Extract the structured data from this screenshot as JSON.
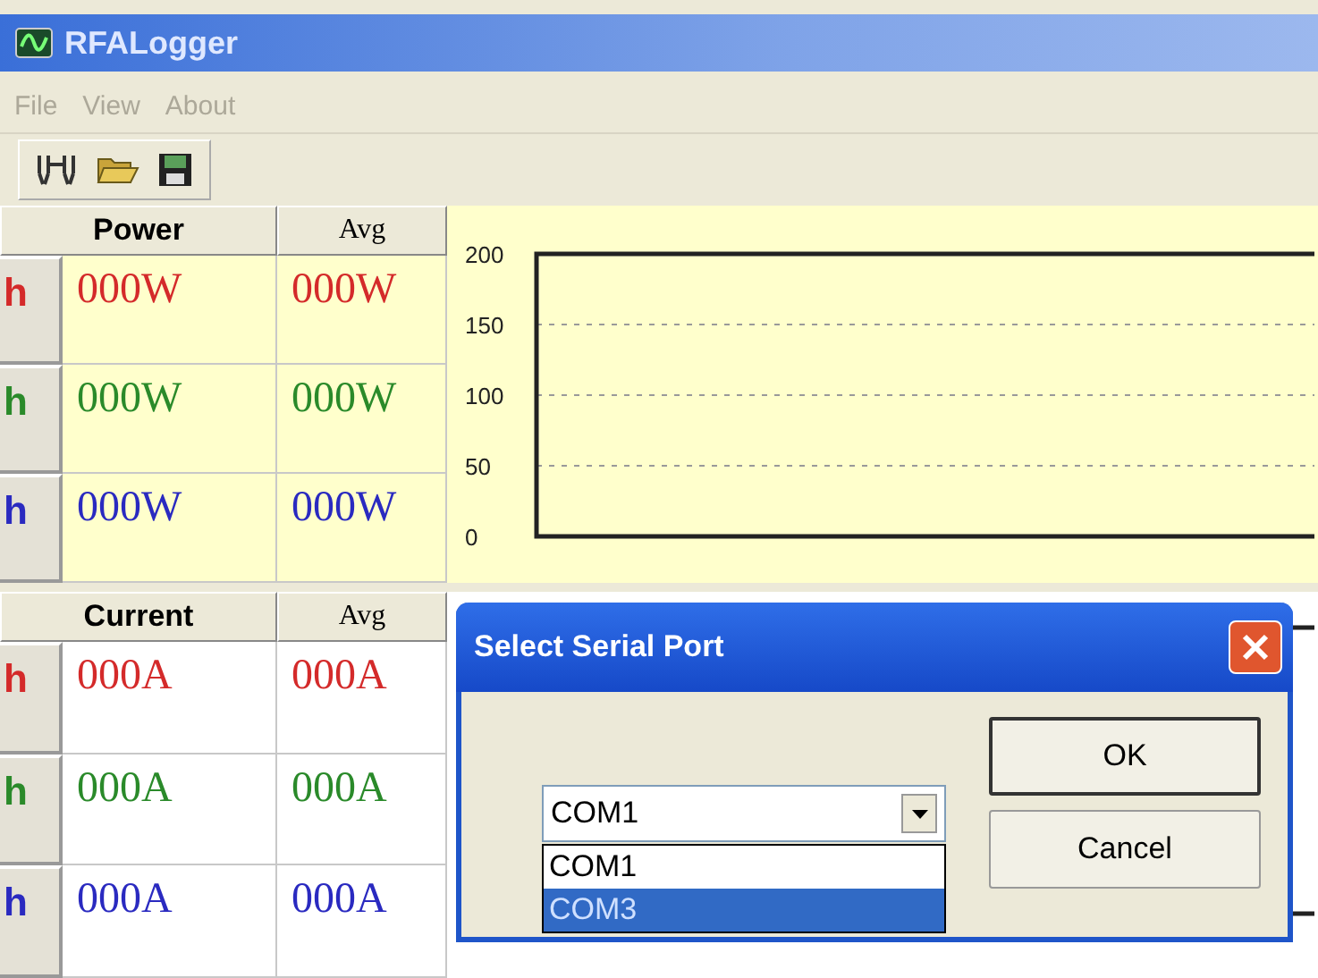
{
  "window": {
    "title": "RFALogger"
  },
  "menu": [
    {
      "label": "File",
      "disabled": true
    },
    {
      "label": "View",
      "disabled": true
    },
    {
      "label": "About",
      "disabled": true
    }
  ],
  "power": {
    "header": "Power",
    "avg_header": "Avg",
    "rows": [
      {
        "label": "h",
        "value": "000W",
        "avg": "000W",
        "color": "#d42a2a"
      },
      {
        "label": "h",
        "value": "000W",
        "avg": "000W",
        "color": "#2a8a2a"
      },
      {
        "label": "h",
        "value": "000W",
        "avg": "000W",
        "color": "#2a2ac0"
      }
    ]
  },
  "power_chart": {
    "y_labels": [
      "200",
      "150",
      "100",
      "50",
      "0"
    ]
  },
  "current": {
    "header": "Current",
    "avg_header": "Avg",
    "rows": [
      {
        "label": "h",
        "value": "000A",
        "avg": "000A",
        "color": "#d42a2a"
      },
      {
        "label": "h",
        "value": "000A",
        "avg": "000A",
        "color": "#2a8a2a"
      },
      {
        "label": "h",
        "value": "000A",
        "avg": "000A",
        "color": "#2a2ac0"
      }
    ]
  },
  "dialog": {
    "title": "Select Serial Port",
    "combo_value": "COM1",
    "options": [
      {
        "label": "COM1",
        "selected": false
      },
      {
        "label": "COM3",
        "selected": true
      }
    ],
    "buttons": [
      "OK",
      "Cancel"
    ]
  }
}
